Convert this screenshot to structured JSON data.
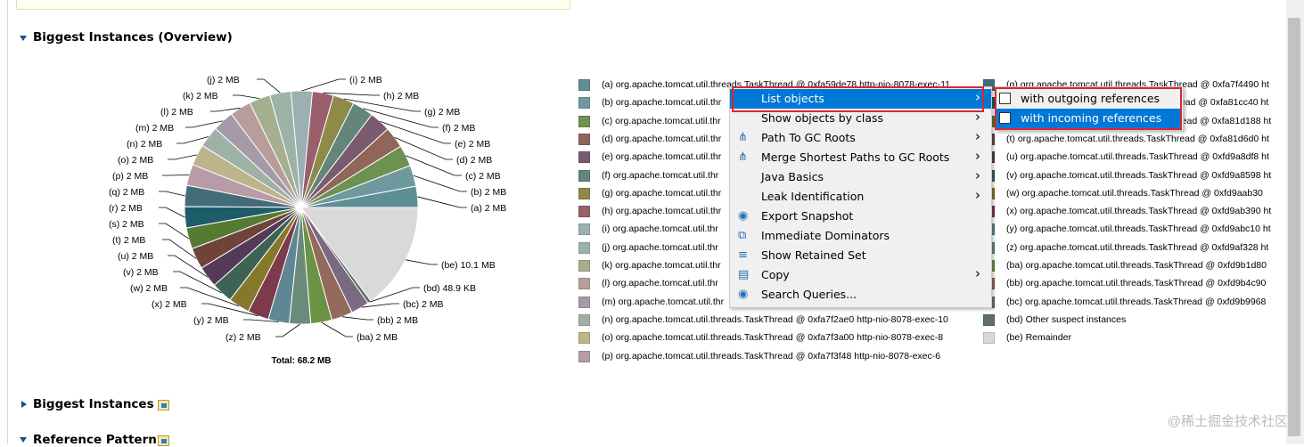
{
  "sections": {
    "overview_title": "Biggest Instances (Overview)",
    "biggest_title": "Biggest Instances",
    "reference_title": "Reference Pattern"
  },
  "chart_data": {
    "type": "pie",
    "total_label": "Total: 68.2 MB",
    "slices": [
      {
        "key": "a",
        "label": "(a)  2 MB",
        "value": 2,
        "color": "#5f8f94"
      },
      {
        "key": "b",
        "label": "(b)  2 MB",
        "value": 2,
        "color": "#6e9a9f"
      },
      {
        "key": "c",
        "label": "(c)  2 MB",
        "value": 2,
        "color": "#6d9151"
      },
      {
        "key": "d",
        "label": "(d)  2 MB",
        "value": 2,
        "color": "#8f6657"
      },
      {
        "key": "e",
        "label": "(e)  2 MB",
        "value": 2,
        "color": "#7a5a6f"
      },
      {
        "key": "f",
        "label": "(f)  2 MB",
        "value": 2,
        "color": "#648579"
      },
      {
        "key": "g",
        "label": "(g)  2 MB",
        "value": 2,
        "color": "#8f8a49"
      },
      {
        "key": "h",
        "label": "(h)  2 MB",
        "value": 2,
        "color": "#995f6b"
      },
      {
        "key": "i",
        "label": "(i)  2 MB",
        "value": 2,
        "color": "#9ab0b3"
      },
      {
        "key": "j",
        "label": "(j)  2 MB",
        "value": 2,
        "color": "#9eb3a8"
      },
      {
        "key": "k",
        "label": "(k)  2 MB",
        "value": 2,
        "color": "#a6af8f"
      },
      {
        "key": "l",
        "label": "(l)  2 MB",
        "value": 2,
        "color": "#b89d9b"
      },
      {
        "key": "m",
        "label": "(m)  2 MB",
        "value": 2,
        "color": "#a59aa7"
      },
      {
        "key": "n",
        "label": "(n)  2 MB",
        "value": 2,
        "color": "#9fb0a6"
      },
      {
        "key": "o",
        "label": "(o)  2 MB",
        "value": 2,
        "color": "#bdb48a"
      },
      {
        "key": "p",
        "label": "(p)  2 MB",
        "value": 2,
        "color": "#b89ba6"
      },
      {
        "key": "q",
        "label": "(q)  2 MB",
        "value": 2,
        "color": "#436c7a"
      },
      {
        "key": "r",
        "label": "(r)  2 MB",
        "value": 2,
        "color": "#1d5c69"
      },
      {
        "key": "s",
        "label": "(s)  2 MB",
        "value": 2,
        "color": "#577a33"
      },
      {
        "key": "t",
        "label": "(t)  2 MB",
        "value": 2,
        "color": "#6e4438"
      },
      {
        "key": "u",
        "label": "(u)  2 MB",
        "value": 2,
        "color": "#543a58"
      },
      {
        "key": "v",
        "label": "(v)  2 MB",
        "value": 2,
        "color": "#3c6353"
      },
      {
        "key": "w",
        "label": "(w)  2 MB",
        "value": 2,
        "color": "#86782b"
      },
      {
        "key": "x",
        "label": "(x)  2 MB",
        "value": 2,
        "color": "#7c3a4b"
      },
      {
        "key": "y",
        "label": "(y)  2 MB",
        "value": 2,
        "color": "#5e8793"
      },
      {
        "key": "z",
        "label": "(z)  2 MB",
        "value": 2,
        "color": "#6a8a7a"
      },
      {
        "key": "ba",
        "label": "(ba)  2 MB",
        "value": 2,
        "color": "#6c9246"
      },
      {
        "key": "bb",
        "label": "(bb)  2 MB",
        "value": 2,
        "color": "#946a5a"
      },
      {
        "key": "bc",
        "label": "(bc)  2 MB",
        "value": 2,
        "color": "#7a6a82"
      },
      {
        "key": "bd",
        "label": "(bd)  48.9 KB",
        "value": 0.05,
        "color": "#5f6e68"
      },
      {
        "key": "be",
        "label": "(be)  10.1 MB",
        "value": 10.1,
        "color": "#d9d9d9"
      }
    ]
  },
  "legend": {
    "col1": [
      {
        "key": "(a)",
        "text": "org.apache.tomcat.util.threads.TaskThread @ 0xfa59de78  http-nio-8078-exec-11",
        "color": "#5f8f94"
      },
      {
        "key": "(b)",
        "text": "org.apache.tomcat.util.thr",
        "color": "#6e9a9f"
      },
      {
        "key": "(c)",
        "text": "org.apache.tomcat.util.thr",
        "color": "#6d9151"
      },
      {
        "key": "(d)",
        "text": "org.apache.tomcat.util.thr",
        "color": "#8f6657"
      },
      {
        "key": "(e)",
        "text": "org.apache.tomcat.util.thr",
        "color": "#7a5a6f"
      },
      {
        "key": "(f)",
        "text": "org.apache.tomcat.util.thr",
        "color": "#648579"
      },
      {
        "key": "(g)",
        "text": "org.apache.tomcat.util.thr",
        "color": "#8f8a49"
      },
      {
        "key": "(h)",
        "text": "org.apache.tomcat.util.thr",
        "color": "#995f6b"
      },
      {
        "key": "(i)",
        "text": "org.apache.tomcat.util.thr",
        "color": "#9ab0b3"
      },
      {
        "key": "(j)",
        "text": "org.apache.tomcat.util.thr",
        "color": "#9eb3a8"
      },
      {
        "key": "(k)",
        "text": "org.apache.tomcat.util.thr",
        "color": "#a6af8f"
      },
      {
        "key": "(l)",
        "text": "org.apache.tomcat.util.thr",
        "color": "#b89d9b"
      },
      {
        "key": "(m)",
        "text": "org.apache.tomcat.util.thr",
        "color": "#a59aa7"
      },
      {
        "key": "(n)",
        "text": "org.apache.tomcat.util.threads.TaskThread @ 0xfa7f2ae0  http-nio-8078-exec-10",
        "color": "#9fb0a6"
      },
      {
        "key": "(o)",
        "text": "org.apache.tomcat.util.threads.TaskThread @ 0xfa7f3a00  http-nio-8078-exec-8",
        "color": "#bdb48a"
      },
      {
        "key": "(p)",
        "text": "org.apache.tomcat.util.threads.TaskThread @ 0xfa7f3f48  http-nio-8078-exec-6",
        "color": "#b89ba6"
      }
    ],
    "col2": [
      {
        "key": "(q)",
        "text": "org.apache.tomcat.util.threads.TaskThread @ 0xfa7f4490  ht",
        "color": "#436c7a"
      },
      {
        "key": "(r)",
        "text": "org.apache.tomcat.util.threads.TaskThread @ 0xfa81cc40  ht",
        "color": "#1d5c69"
      },
      {
        "key": "(s)",
        "text": "org.apache.tomcat.util.threads.TaskThread @ 0xfa81d188  ht",
        "color": "#577a33"
      },
      {
        "key": "(t)",
        "text": "org.apache.tomcat.util.threads.TaskThread @ 0xfa81d6d0  ht",
        "color": "#6e4438"
      },
      {
        "key": "(u)",
        "text": "org.apache.tomcat.util.threads.TaskThread @ 0xfd9a8df8  ht",
        "color": "#543a58"
      },
      {
        "key": "(v)",
        "text": "org.apache.tomcat.util.threads.TaskThread @ 0xfd9a8598  ht",
        "color": "#3c6353"
      },
      {
        "key": "(w)",
        "text": "org.apache.tomcat.util.threads.TaskThread @ 0xfd9aab30",
        "color": "#86782b"
      },
      {
        "key": "(x)",
        "text": "org.apache.tomcat.util.threads.TaskThread @ 0xfd9ab390  ht",
        "color": "#7c3a4b"
      },
      {
        "key": "(y)",
        "text": "org.apache.tomcat.util.threads.TaskThread @ 0xfd9abc10  ht",
        "color": "#5e8793"
      },
      {
        "key": "(z)",
        "text": "org.apache.tomcat.util.threads.TaskThread @ 0xfd9af328  ht",
        "color": "#6a8a7a"
      },
      {
        "key": "(ba)",
        "text": "org.apache.tomcat.util.threads.TaskThread @ 0xfd9b1d80",
        "color": "#6c9246"
      },
      {
        "key": "(bb)",
        "text": "org.apache.tomcat.util.threads.TaskThread @ 0xfd9b4c90",
        "color": "#946a5a"
      },
      {
        "key": "(bc)",
        "text": "org.apache.tomcat.util.threads.TaskThread @ 0xfd9b9968",
        "color": "#7a6a82"
      },
      {
        "key": "(bd)",
        "text": "Other suspect instances",
        "color": "#5f6e68"
      },
      {
        "key": "(be)",
        "text": "Remainder",
        "color": "#d9d9d9"
      }
    ]
  },
  "context_menu": {
    "items": [
      {
        "label": "List objects",
        "submenu": true,
        "icon": "",
        "selected": true
      },
      {
        "label": "Show objects by class",
        "submenu": true,
        "icon": ""
      },
      {
        "label": "Path To GC Roots",
        "submenu": true,
        "icon": "tree-icon"
      },
      {
        "label": "Merge Shortest Paths to GC Roots",
        "submenu": true,
        "icon": "merge-icon"
      },
      {
        "label": "Java Basics",
        "submenu": true,
        "icon": ""
      },
      {
        "label": "Leak Identification",
        "submenu": true,
        "icon": ""
      },
      {
        "label": "Export Snapshot",
        "submenu": false,
        "icon": "database-icon"
      },
      {
        "label": "Immediate Dominators",
        "submenu": false,
        "icon": "dominator-icon"
      },
      {
        "label": "Show Retained Set",
        "submenu": false,
        "icon": "list-icon"
      },
      {
        "label": "Copy",
        "submenu": true,
        "icon": "copy-icon"
      },
      {
        "label": "Search Queries...",
        "submenu": false,
        "icon": "search-db-icon"
      }
    ]
  },
  "submenu": {
    "items": [
      {
        "label": "with outgoing references",
        "icon": "outgoing-icon"
      },
      {
        "label": "with incoming references",
        "icon": "incoming-icon",
        "selected": true
      }
    ]
  },
  "watermark": "@稀土掘金技术社区",
  "colors": {
    "selection": "#0078d7",
    "highlight_box": "#e0242f",
    "twisty": "#1b4f8a"
  }
}
